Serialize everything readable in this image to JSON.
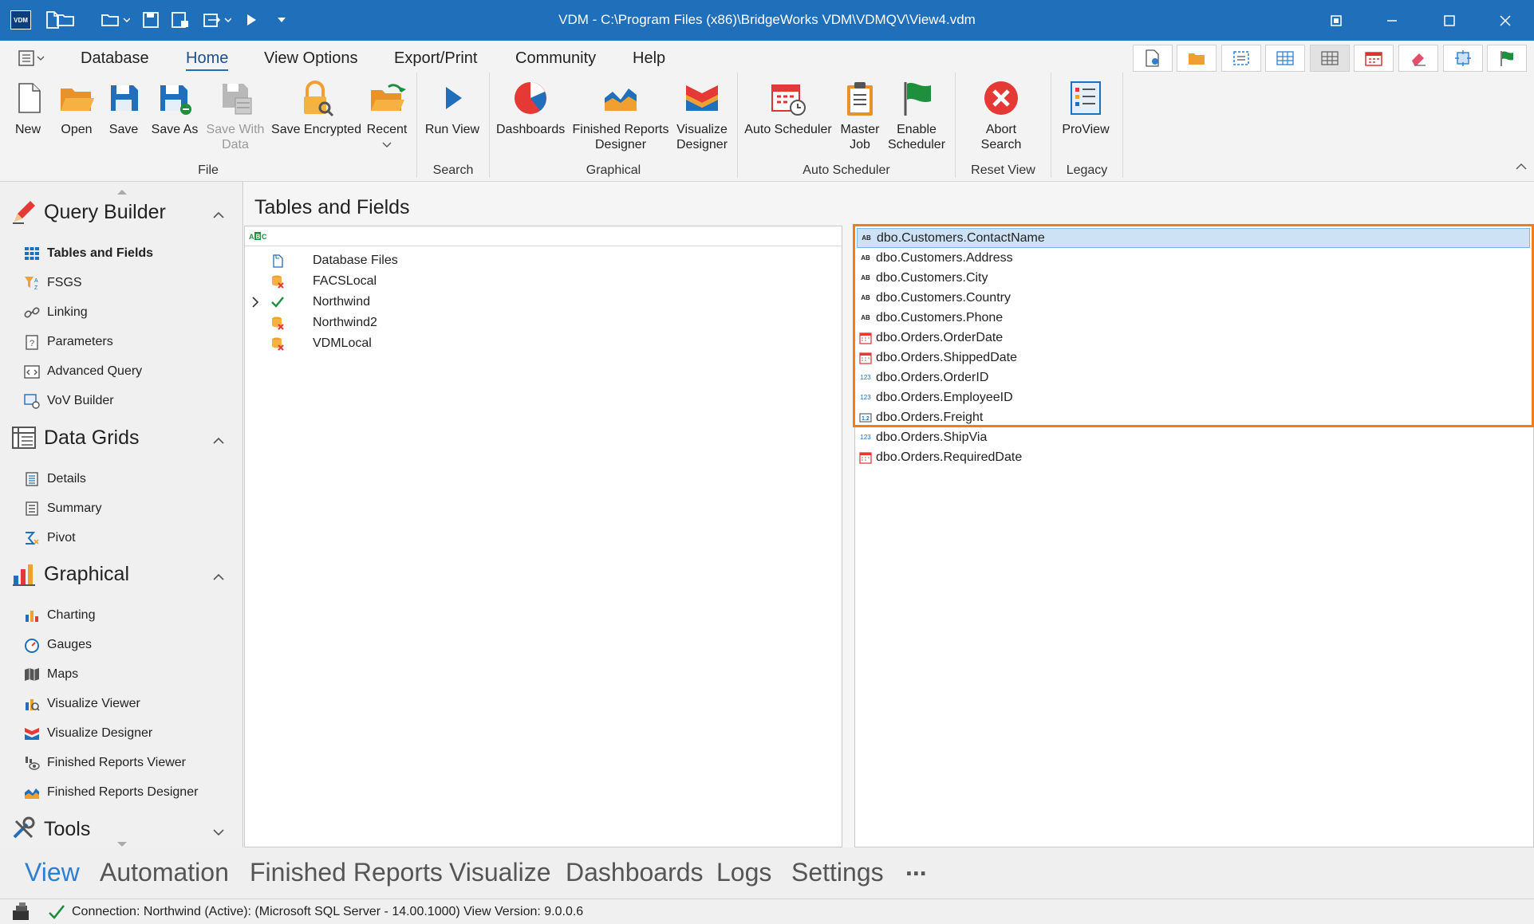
{
  "window": {
    "app_badge": "VDM",
    "title": "VDM - C:\\Program Files (x86)\\BridgeWorks VDM\\VDMQV\\View4.vdm"
  },
  "ribbon": {
    "menu_tabs": [
      "Database",
      "Home",
      "View Options",
      "Export/Print",
      "Community",
      "Help"
    ],
    "active_tab": "Home",
    "buttons": {
      "new": "New",
      "open": "Open",
      "save": "Save",
      "save_as": "Save As",
      "save_with_data_1": "Save With",
      "save_with_data_2": "Data",
      "save_encrypted": "Save Encrypted",
      "recent": "Recent",
      "run_view": "Run View",
      "dashboards": "Dashboards",
      "finished_reports_1": "Finished Reports",
      "finished_reports_2": "Designer",
      "visualize_1": "Visualize",
      "visualize_2": "Designer",
      "auto_scheduler": "Auto Scheduler",
      "master_job_1": "Master",
      "master_job_2": "Job",
      "enable_scheduler_1": "Enable",
      "enable_scheduler_2": "Scheduler",
      "abort_search_1": "Abort",
      "abort_search_2": "Search",
      "proview": "ProView"
    },
    "groups": {
      "file": "File",
      "search": "Search",
      "graphical": "Graphical",
      "auto_scheduler": "Auto Scheduler",
      "reset_view": "Reset View",
      "legacy": "Legacy"
    }
  },
  "nav": {
    "query_builder": {
      "title": "Query Builder",
      "items": [
        "Tables and Fields",
        "FSGS",
        "Linking",
        "Parameters",
        "Advanced Query",
        "VoV Builder"
      ]
    },
    "data_grids": {
      "title": "Data Grids",
      "items": [
        "Details",
        "Summary",
        "Pivot"
      ]
    },
    "graphical": {
      "title": "Graphical",
      "items": [
        "Charting",
        "Gauges",
        "Maps",
        "Visualize Viewer",
        "Visualize Designer",
        "Finished Reports Viewer",
        "Finished Reports Designer"
      ]
    },
    "tools": {
      "title": "Tools"
    }
  },
  "main": {
    "title": "Tables and Fields",
    "tree": [
      {
        "label": "Database Files",
        "status": "file"
      },
      {
        "label": "FACSLocal",
        "status": "error"
      },
      {
        "label": "Northwind",
        "status": "ok"
      },
      {
        "label": "Northwind2",
        "status": "error"
      },
      {
        "label": "VDMLocal",
        "status": "error"
      }
    ],
    "fields": [
      {
        "label": "dbo.Customers.ContactName",
        "type": "text"
      },
      {
        "label": "dbo.Customers.Address",
        "type": "text"
      },
      {
        "label": "dbo.Customers.City",
        "type": "text"
      },
      {
        "label": "dbo.Customers.Country",
        "type": "text"
      },
      {
        "label": "dbo.Customers.Phone",
        "type": "text"
      },
      {
        "label": "dbo.Orders.OrderDate",
        "type": "date"
      },
      {
        "label": "dbo.Orders.ShippedDate",
        "type": "date"
      },
      {
        "label": "dbo.Orders.OrderID",
        "type": "int"
      },
      {
        "label": "dbo.Orders.EmployeeID",
        "type": "int"
      },
      {
        "label": "dbo.Orders.Freight",
        "type": "decimal"
      },
      {
        "label": "dbo.Orders.ShipVia",
        "type": "int"
      },
      {
        "label": "dbo.Orders.RequiredDate",
        "type": "date"
      }
    ],
    "selected_field": "dbo.Customers.ContactName"
  },
  "bottom_tabs": [
    "View",
    "Automation",
    "Finished Reports",
    "Visualize",
    "Dashboards",
    "Logs",
    "Settings",
    "..."
  ],
  "status_bar": {
    "text": "Connection: Northwind (Active): (Microsoft SQL Server - 14.00.1000) View Version: 9.0.0.6"
  },
  "colors": {
    "titlebar": "#1f6fba",
    "accent": "#2e7fd0",
    "highlight_border": "#f07d1a",
    "selection": "#cde2f5"
  }
}
